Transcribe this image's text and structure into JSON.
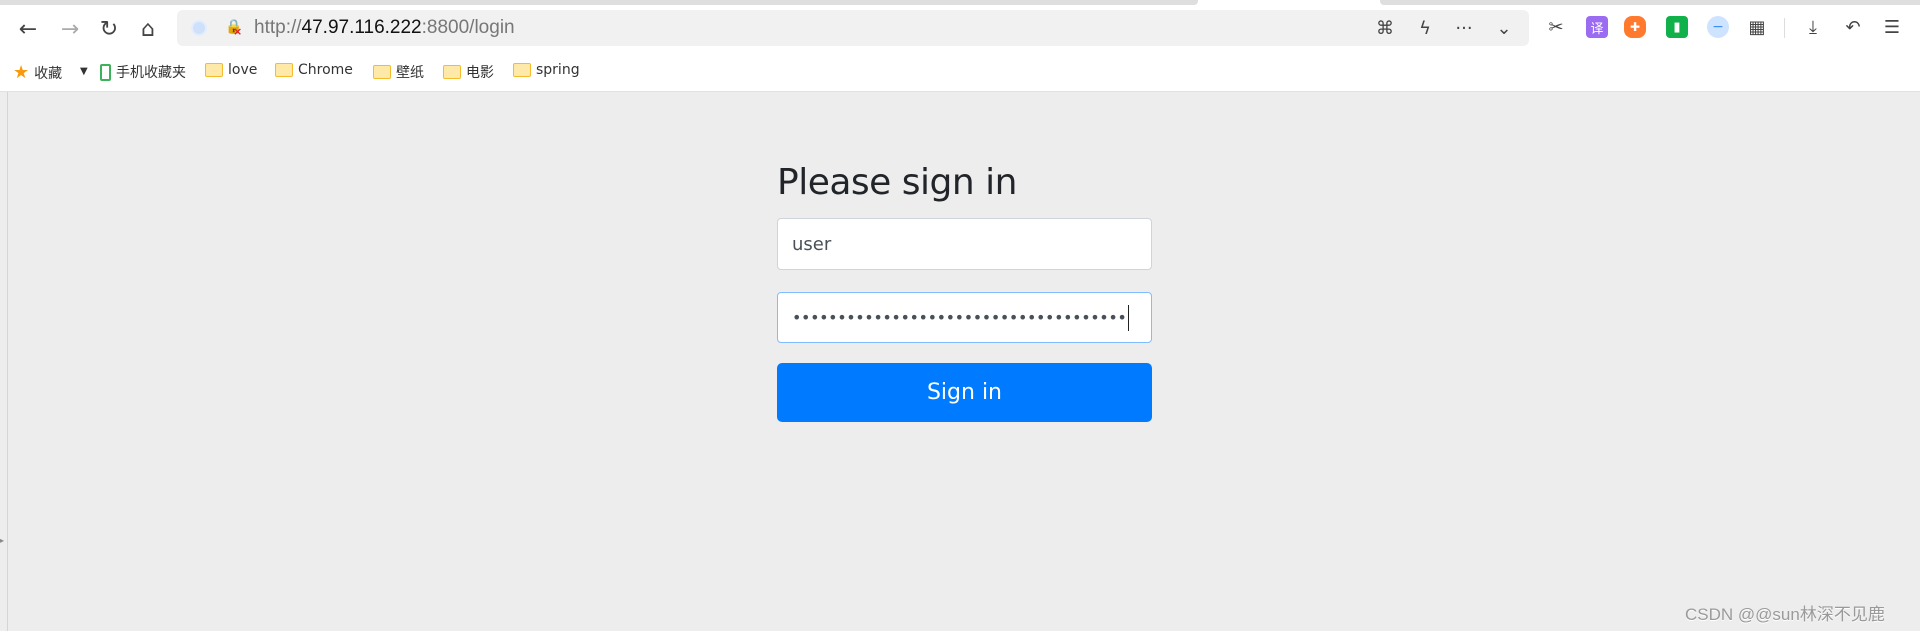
{
  "browser": {
    "url_prefix": "http://",
    "url_host": "47.97.116.222",
    "url_rest": ":8800/login",
    "nav_icons": [
      "back-icon",
      "forward-icon",
      "reload-icon",
      "home-icon"
    ],
    "address_icons": [
      "translate-icon",
      "lightning-icon",
      "more-icon",
      "chevron-down-icon"
    ],
    "toolbar_icons": [
      "scissors-icon",
      "translate-extension-icon",
      "game-icon",
      "reader-icon",
      "adblock-icon",
      "apps-grid-icon",
      "download-icon",
      "undo-icon",
      "menu-icon"
    ],
    "translate_glyph": "译"
  },
  "bookmarks": {
    "favorites_label": "收藏",
    "mobile_label": "手机收藏夹",
    "folders": [
      "love",
      "Chrome",
      "壁纸",
      "电影",
      "spring"
    ]
  },
  "login": {
    "title": "Please sign in",
    "username_value": "user",
    "password_masked": "•••••••••••••••••••••••••••••••••••••",
    "submit_label": "Sign in",
    "accent_color": "#007bff"
  },
  "watermark": "CSDN @@sun林深不见鹿"
}
